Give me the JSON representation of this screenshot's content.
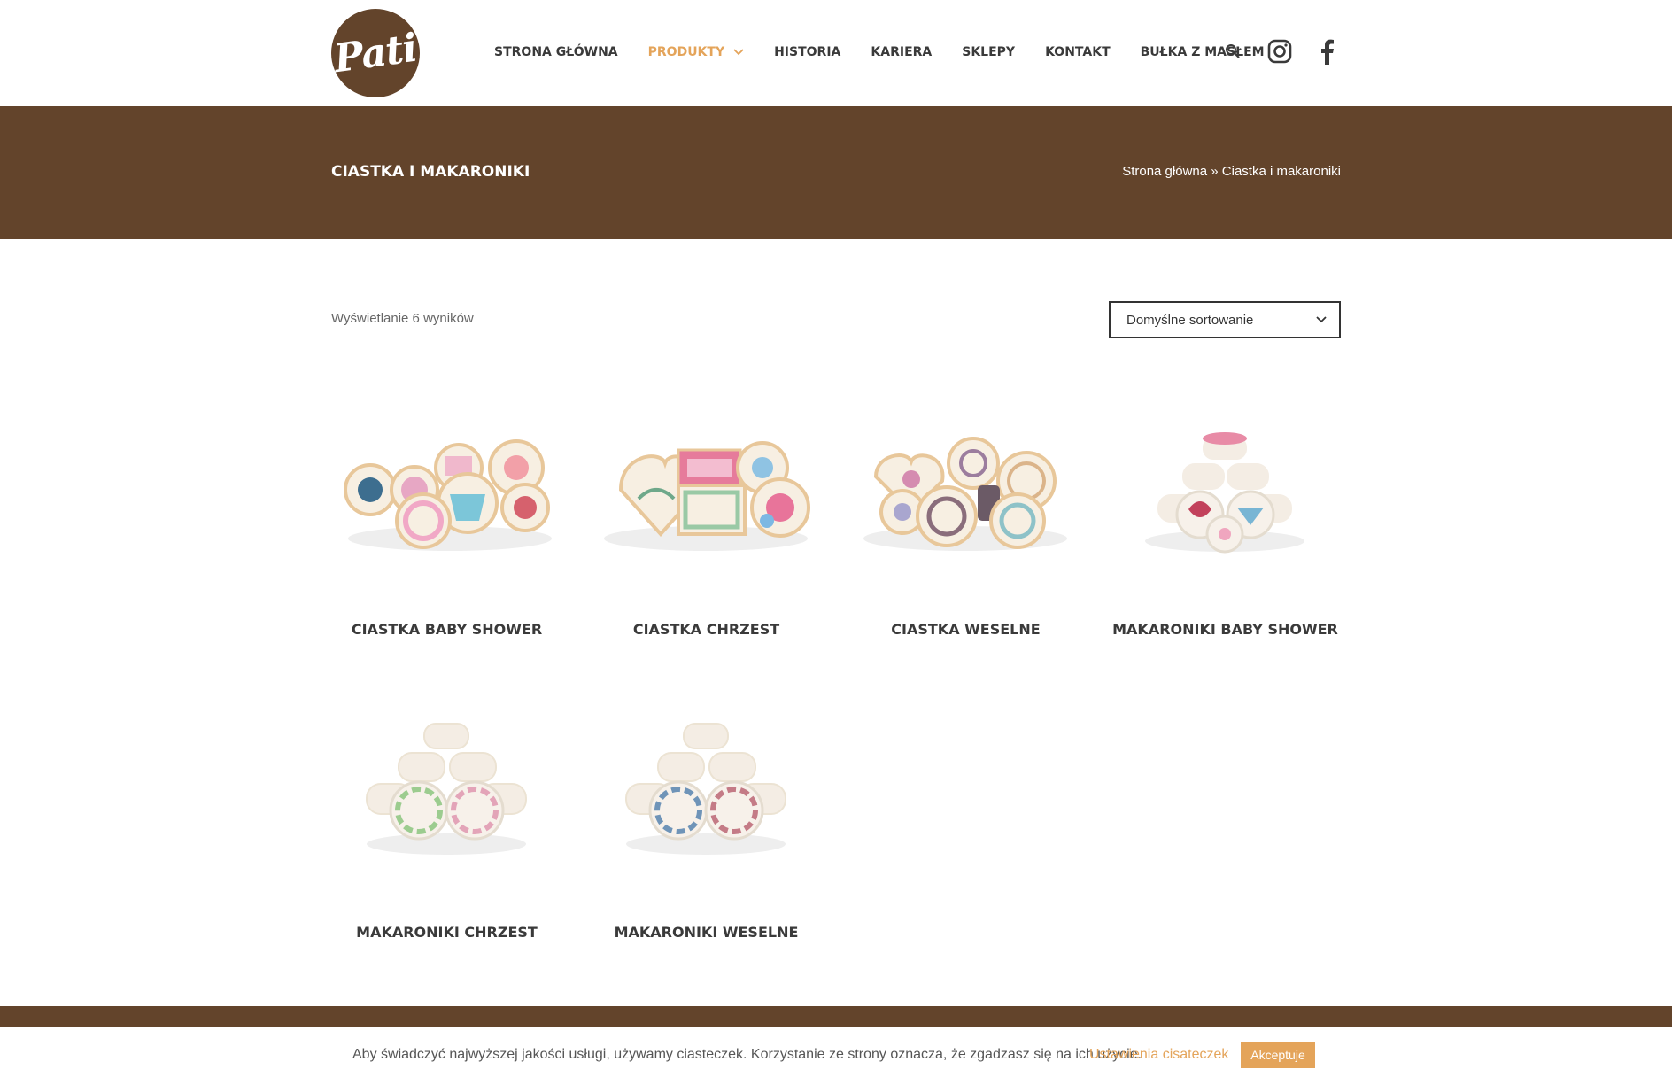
{
  "brand": {
    "logo_text": "Pati",
    "primary_color": "#63442b",
    "accent_color": "#e4a45a"
  },
  "nav": {
    "items": [
      {
        "label": "STRONA GŁÓWNA"
      },
      {
        "label": "PRODUKTY"
      },
      {
        "label": "HISTORIA"
      },
      {
        "label": "KARIERA"
      },
      {
        "label": "SKLEPY"
      },
      {
        "label": "KONTAKT"
      },
      {
        "label": "BUŁKA Z MASŁEM"
      }
    ],
    "icons": [
      "search-icon",
      "instagram-icon",
      "facebook-icon"
    ]
  },
  "page": {
    "title": "CIASTKA I MAKARONIKI",
    "breadcrumb": {
      "home": "Strona główna",
      "separator": "»",
      "current": "Ciastka i makaroniki"
    }
  },
  "toolbar": {
    "results": "Wyświetlanie 6 wyników",
    "sort_selected": "Domyślne sortowanie"
  },
  "products": [
    {
      "name": "CIASTKA BABY SHOWER"
    },
    {
      "name": "CIASTKA CHRZEST"
    },
    {
      "name": "CIASTKA WESELNE"
    },
    {
      "name": "MAKARONIKI BABY SHOWER"
    },
    {
      "name": "MAKARONIKI CHRZEST"
    },
    {
      "name": "MAKARONIKI WESELNE"
    }
  ],
  "cookie": {
    "text": "Aby świadczyć najwyższej jakości usługi, używamy ciasteczek. Korzystanie ze strony oznacza, że zgadzasz się na ich użycie.",
    "settings_label": "Ustawienia cisateczek",
    "accept_label": "Akceptuje"
  }
}
